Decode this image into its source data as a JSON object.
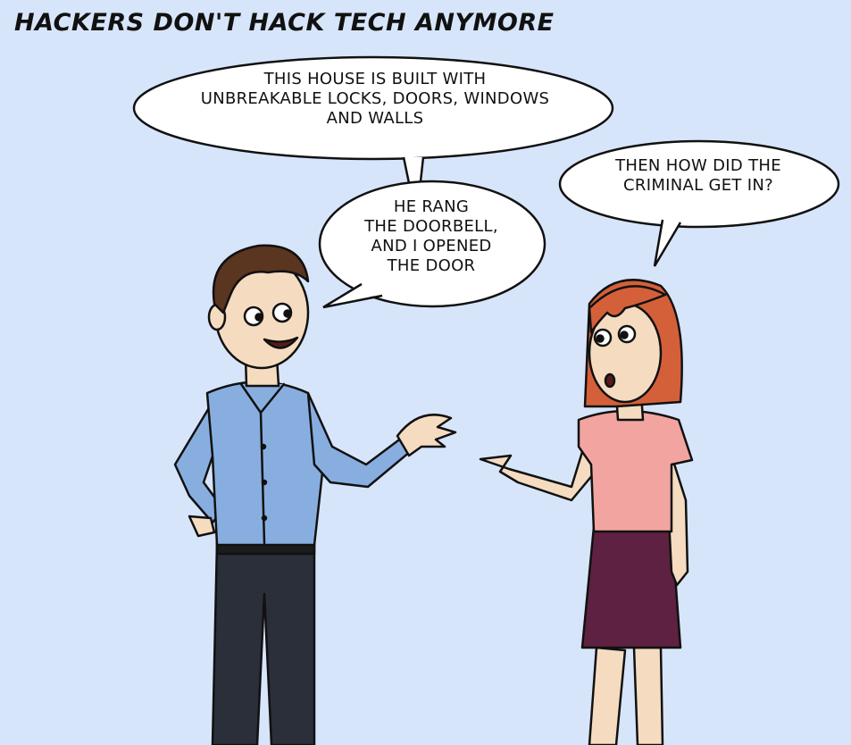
{
  "title": "HACKERS DON'T HACK TECH ANYMORE",
  "bubbles": {
    "house": [
      "THIS HOUSE IS BUILT WITH",
      "UNBREAKABLE LOCKS, DOORS, WINDOWS",
      "AND WALLS"
    ],
    "man": [
      "HE RANG",
      "THE DOORBELL,",
      "AND I OPENED",
      "THE DOOR"
    ],
    "woman": [
      "THEN HOW DID THE",
      "CRIMINAL GET IN?"
    ]
  },
  "colors": {
    "background": "#d7e5fb",
    "man_shirt": "#88aee0",
    "man_pants": "#2b2f3a",
    "man_hair": "#5a3520",
    "woman_hair": "#d4603a",
    "woman_top": "#f2a5a0",
    "woman_skirt": "#5e2141",
    "skin": "#f5dcc0"
  }
}
